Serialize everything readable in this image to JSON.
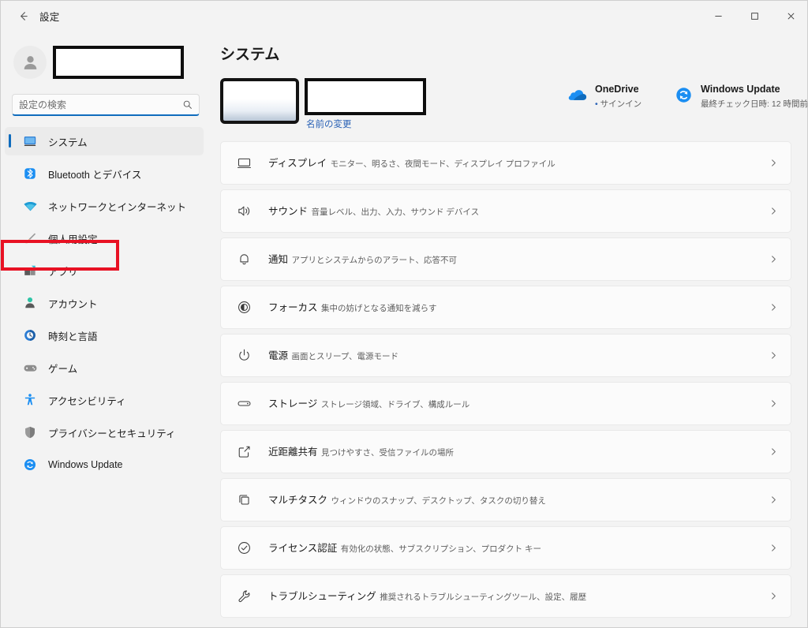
{
  "window": {
    "title": "設定",
    "back_icon": "arrow-left-icon",
    "controls": [
      {
        "name": "minimize",
        "glyph": "minimize-icon"
      },
      {
        "name": "maximize",
        "glyph": "maximize-icon"
      },
      {
        "name": "close",
        "glyph": "close-icon"
      }
    ]
  },
  "sidebar": {
    "account": {
      "avatar_icon": "person-avatar-icon",
      "name": ""
    },
    "search": {
      "placeholder": "設定の検索",
      "value": "",
      "icon": "search-icon"
    },
    "items": [
      {
        "label": "システム",
        "icon": "monitor-icon",
        "selected": true
      },
      {
        "label": "Bluetooth とデバイス",
        "icon": "bluetooth-icon",
        "selected": false
      },
      {
        "label": "ネットワークとインターネット",
        "icon": "wifi-icon",
        "selected": false
      },
      {
        "label": "個人用設定",
        "icon": "paintbrush-icon",
        "selected": false,
        "highlighted": true
      },
      {
        "label": "アプリ",
        "icon": "apps-icon",
        "selected": false
      },
      {
        "label": "アカウント",
        "icon": "account-icon",
        "selected": false
      },
      {
        "label": "時刻と言語",
        "icon": "clock-globe-icon",
        "selected": false
      },
      {
        "label": "ゲーム",
        "icon": "gamepad-icon",
        "selected": false
      },
      {
        "label": "アクセシビリティ",
        "icon": "accessibility-icon",
        "selected": false
      },
      {
        "label": "プライバシーとセキュリティ",
        "icon": "shield-icon",
        "selected": false
      },
      {
        "label": "Windows Update",
        "icon": "update-icon",
        "selected": false
      }
    ]
  },
  "main": {
    "page_title": "システム",
    "device": {
      "thumbnail_icon": "device-thumbnail",
      "name": "",
      "rename_label": "名前の変更"
    },
    "status": [
      {
        "title": "OneDrive",
        "sub": "サインイン",
        "sub_prefix": "•",
        "icon": "onedrive-cloud-icon",
        "color": "#0f6cbd"
      },
      {
        "title": "Windows Update",
        "sub": "最終チェック日時: 12 時間前",
        "sub_prefix": "",
        "icon": "windows-update-icon",
        "color": "#1a8cf0"
      }
    ],
    "cards": [
      {
        "title": "ディスプレイ",
        "sub": "モニター、明るさ、夜間モード、ディスプレイ プロファイル",
        "icon": "monitor-icon"
      },
      {
        "title": "サウンド",
        "sub": "音量レベル、出力、入力、サウンド デバイス",
        "icon": "speaker-icon"
      },
      {
        "title": "通知",
        "sub": "アプリとシステムからのアラート、応答不可",
        "icon": "bell-icon"
      },
      {
        "title": "フォーカス",
        "sub": "集中の妨げとなる通知を減らす",
        "icon": "focus-icon"
      },
      {
        "title": "電源",
        "sub": "画面とスリープ、電源モード",
        "icon": "power-icon"
      },
      {
        "title": "ストレージ",
        "sub": "ストレージ領域、ドライブ、構成ルール",
        "icon": "storage-icon"
      },
      {
        "title": "近距離共有",
        "sub": "見つけやすさ、受信ファイルの場所",
        "icon": "share-icon"
      },
      {
        "title": "マルチタスク",
        "sub": "ウィンドウのスナップ、デスクトップ、タスクの切り替え",
        "icon": "multitask-icon"
      },
      {
        "title": "ライセンス認証",
        "sub": "有効化の状態、サブスクリプション、プロダクト キー",
        "icon": "check-circle-icon"
      },
      {
        "title": "トラブルシューティング",
        "sub": "推奨されるトラブルシューティングツール、設定、履歴",
        "icon": "wrench-icon"
      }
    ],
    "chevron_icon": "chevron-right-icon"
  },
  "colors": {
    "accent": "#0f6cbd",
    "annotation": "#e81123",
    "page_bg": "#f3f3f3",
    "card_bg": "#fbfbfb",
    "link": "#2a62b6"
  }
}
